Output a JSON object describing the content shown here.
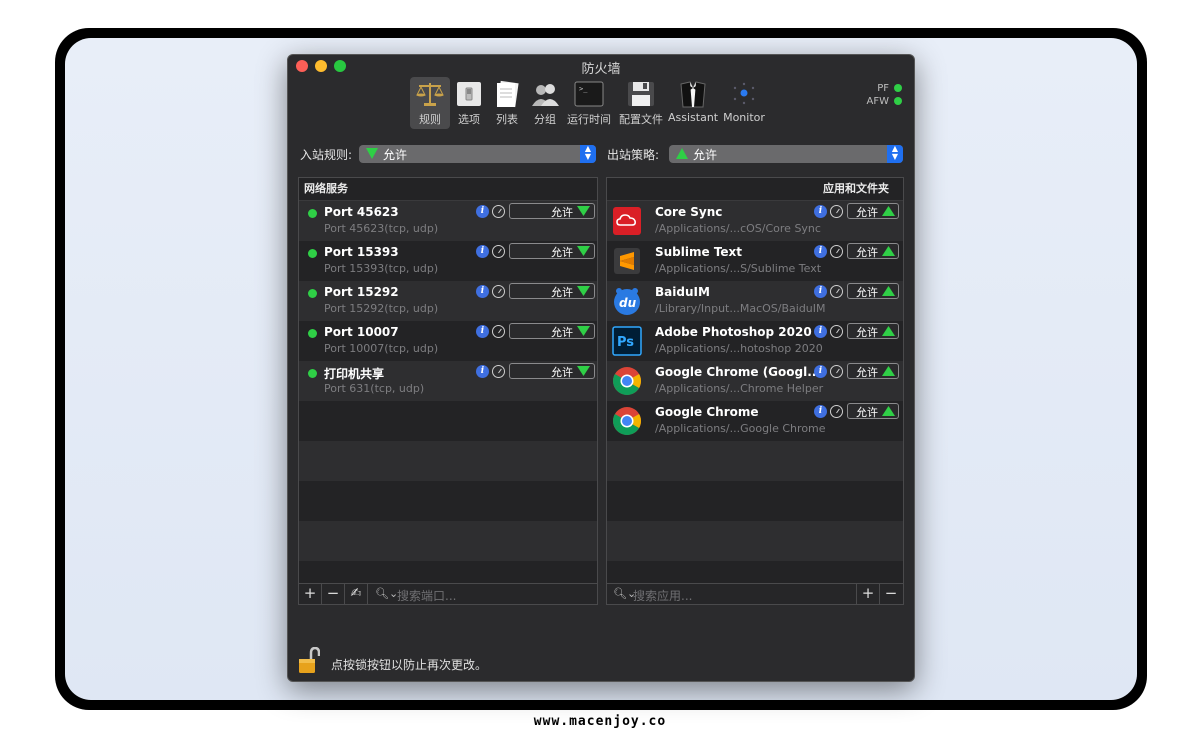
{
  "window": {
    "title": "防火墙"
  },
  "toolbar": {
    "items": [
      {
        "label": "规则",
        "icon": "scales-icon"
      },
      {
        "label": "选项",
        "icon": "switch-icon"
      },
      {
        "label": "列表",
        "icon": "list-icon"
      },
      {
        "label": "分组",
        "icon": "group-icon"
      },
      {
        "label": "运行时间",
        "icon": "terminal-icon"
      },
      {
        "label": "配置文件",
        "icon": "floppy-icon"
      },
      {
        "label": "Assistant",
        "icon": "tuxedo-icon"
      },
      {
        "label": "Monitor",
        "icon": "monitor-icon"
      }
    ]
  },
  "status": {
    "pf": "PF",
    "afw": "AFW",
    "color": "#2fcf46"
  },
  "inbound": {
    "label": "入站规则:",
    "value": "允许"
  },
  "outbound": {
    "label": "出站策略:",
    "value": "允许"
  },
  "left_panel": {
    "header": "网络服务",
    "rows": [
      {
        "title": "Port 45623",
        "sub": "Port 45623(tcp, udp)",
        "action": "允许"
      },
      {
        "title": "Port 15393",
        "sub": "Port 15393(tcp, udp)",
        "action": "允许"
      },
      {
        "title": "Port 15292",
        "sub": "Port 15292(tcp, udp)",
        "action": "允许"
      },
      {
        "title": "Port 10007",
        "sub": "Port 10007(tcp, udp)",
        "action": "允许"
      },
      {
        "title": "打印机共享",
        "sub": "Port 631(tcp, udp)",
        "action": "允许"
      }
    ],
    "search_placeholder": "搜索端口..."
  },
  "right_panel": {
    "header": "应用和文件夹",
    "rows": [
      {
        "title": "Core Sync",
        "sub": "/Applications/...cOS/Core Sync",
        "action": "允许",
        "icon": "creative-cloud-icon"
      },
      {
        "title": "Sublime Text",
        "sub": "/Applications/...S/Sublime Text",
        "action": "允许",
        "icon": "sublime-text-icon"
      },
      {
        "title": "BaiduIM",
        "sub": "/Library/Input...MacOS/BaiduIM",
        "action": "允许",
        "icon": "baidu-im-icon"
      },
      {
        "title": "Adobe Photoshop 2020",
        "sub": "/Applications/...hotoshop 2020",
        "action": "允许",
        "icon": "photoshop-icon"
      },
      {
        "title": "Google Chrome (Googl...",
        "sub": "/Applications/...Chrome Helper",
        "action": "允许",
        "icon": "chrome-icon"
      },
      {
        "title": "Google Chrome",
        "sub": "/Applications/...Google Chrome",
        "action": "允许",
        "icon": "chrome-icon"
      }
    ],
    "search_placeholder": "搜索应用..."
  },
  "lock": {
    "text": "点按锁按钮以防止再次更改。"
  },
  "footer": {
    "url": "www.macenjoy.co"
  }
}
